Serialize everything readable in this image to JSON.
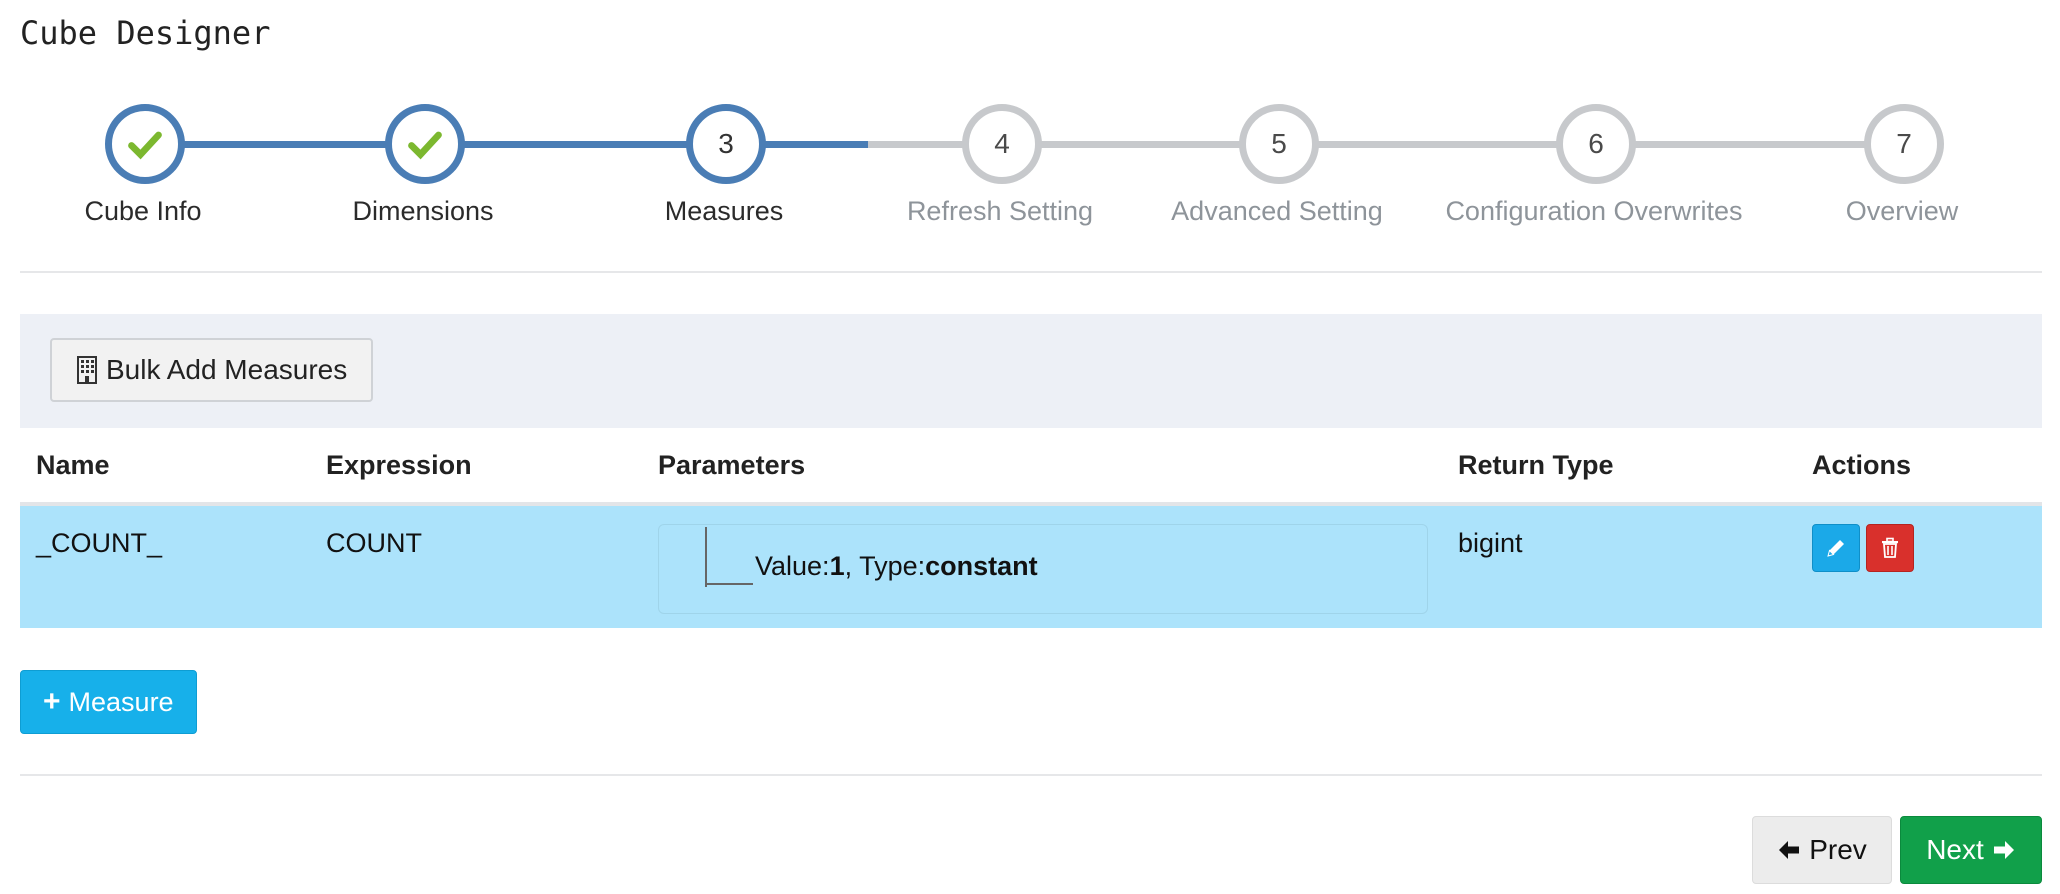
{
  "page": {
    "title": "Cube Designer"
  },
  "wizard": {
    "steps": [
      {
        "label": "Cube Info",
        "number": "1",
        "status": "completed",
        "icon": "check-icon"
      },
      {
        "label": "Dimensions",
        "number": "2",
        "status": "completed",
        "icon": "check-icon"
      },
      {
        "label": "Measures",
        "number": "3",
        "status": "active"
      },
      {
        "label": "Refresh Setting",
        "number": "4",
        "status": "pending"
      },
      {
        "label": "Advanced Setting",
        "number": "5",
        "status": "pending"
      },
      {
        "label": "Configuration Overwrites",
        "number": "6",
        "status": "pending"
      },
      {
        "label": "Overview",
        "number": "7",
        "status": "pending"
      }
    ]
  },
  "toolbar": {
    "bulk_add_label": "Bulk Add Measures",
    "bulk_add_icon": "building-icon"
  },
  "table": {
    "columns": [
      "Name",
      "Expression",
      "Parameters",
      "Return Type",
      "Actions"
    ],
    "rows": [
      {
        "name": "_COUNT_",
        "expression": "COUNT",
        "param_value_label": "Value:",
        "param_value": "1",
        "param_sep": ", ",
        "param_type_label": "Type:",
        "param_type": "constant",
        "return_type": "bigint"
      }
    ]
  },
  "actions": {
    "add_measure_label": "Measure",
    "prev_label": "Prev",
    "next_label": "Next"
  },
  "colors": {
    "completed": "#4a7db5",
    "pending": "#c7c9cc",
    "check": "#7cb82f",
    "row_highlight": "#ace3fb",
    "edit": "#1ba9e8",
    "delete": "#d9302c",
    "next": "#11a04a"
  }
}
